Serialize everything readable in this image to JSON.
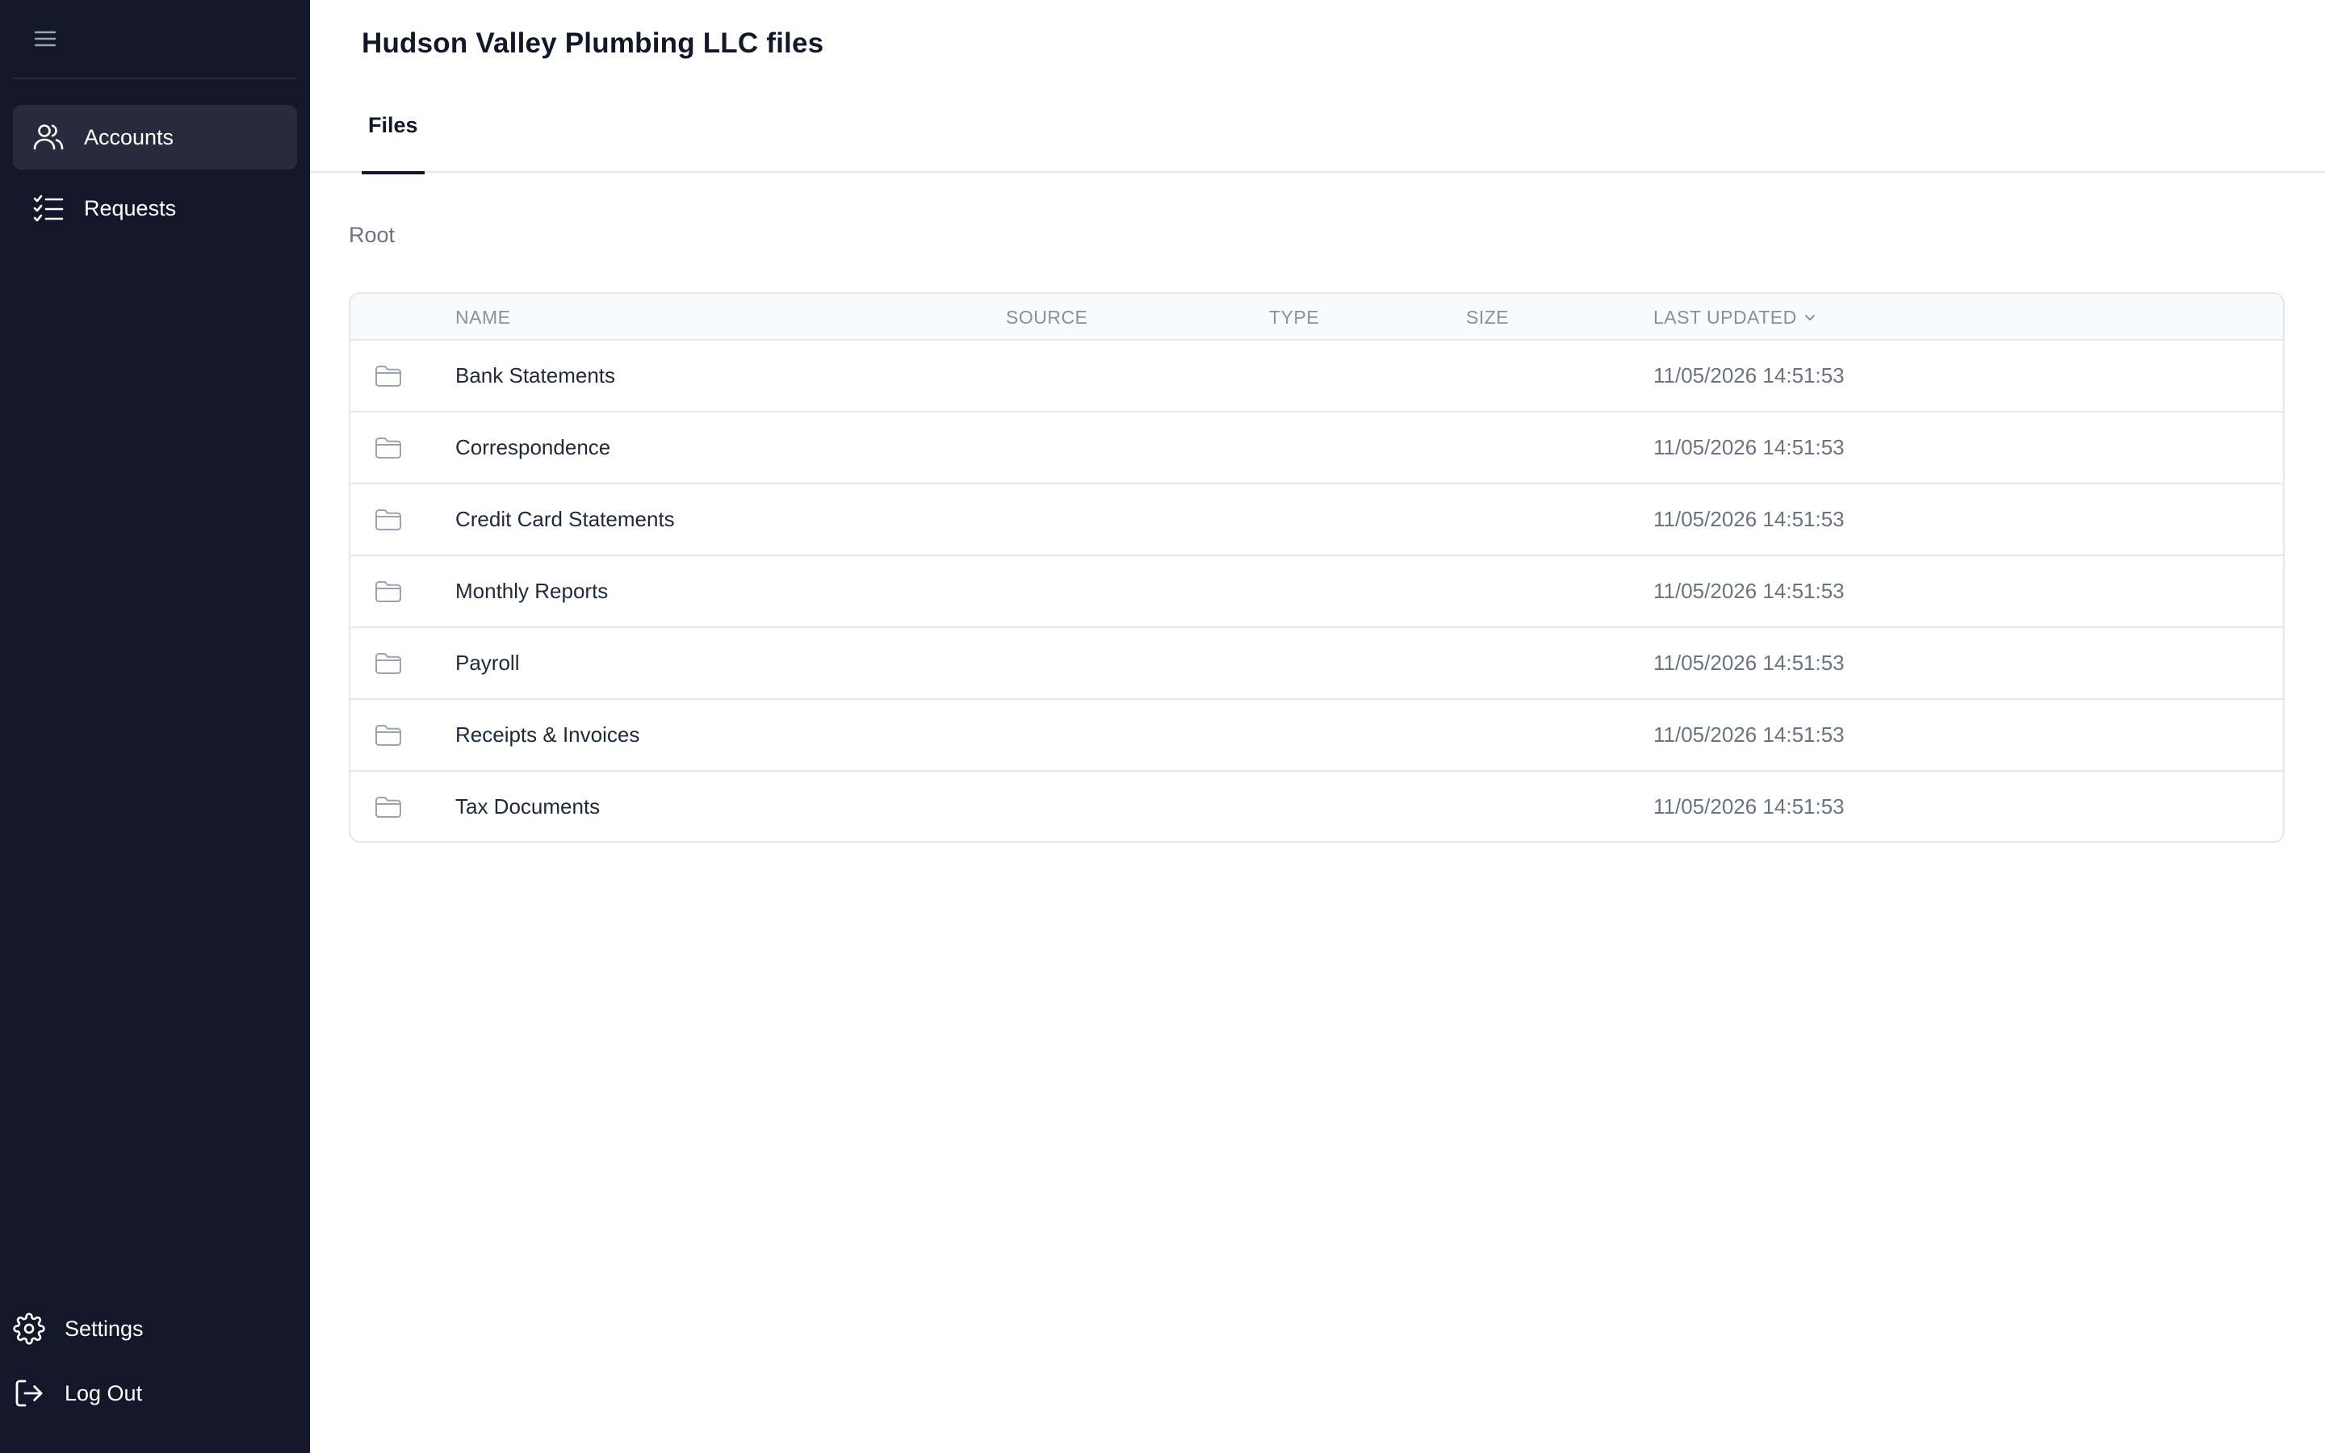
{
  "sidebar": {
    "menu_icon": "hamburger-icon",
    "items": [
      {
        "label": "Accounts",
        "icon": "users-icon",
        "active": true
      },
      {
        "label": "Requests",
        "icon": "checklist-icon",
        "active": false
      }
    ],
    "bottom": [
      {
        "label": "Settings",
        "icon": "gear-icon"
      },
      {
        "label": "Log Out",
        "icon": "logout-icon"
      }
    ]
  },
  "header": {
    "title": "Hudson Valley Plumbing LLC files",
    "tabs": [
      {
        "label": "Files",
        "active": true
      }
    ]
  },
  "breadcrumb": {
    "root": "Root"
  },
  "table": {
    "columns": {
      "name": "NAME",
      "source": "SOURCE",
      "type": "TYPE",
      "size": "SIZE",
      "last_updated": "LAST UPDATED"
    },
    "sort_icon": "chevron-down-icon",
    "rows": [
      {
        "name": "Bank Statements",
        "source": "",
        "type": "",
        "size": "",
        "last_updated": "11/05/2026 14:51:53",
        "icon": "folder-icon"
      },
      {
        "name": "Correspondence",
        "source": "",
        "type": "",
        "size": "",
        "last_updated": "11/05/2026 14:51:53",
        "icon": "folder-icon"
      },
      {
        "name": "Credit Card Statements",
        "source": "",
        "type": "",
        "size": "",
        "last_updated": "11/05/2026 14:51:53",
        "icon": "folder-icon"
      },
      {
        "name": "Monthly Reports",
        "source": "",
        "type": "",
        "size": "",
        "last_updated": "11/05/2026 14:51:53",
        "icon": "folder-icon"
      },
      {
        "name": "Payroll",
        "source": "",
        "type": "",
        "size": "",
        "last_updated": "11/05/2026 14:51:53",
        "icon": "folder-icon"
      },
      {
        "name": "Receipts & Invoices",
        "source": "",
        "type": "",
        "size": "",
        "last_updated": "11/05/2026 14:51:53",
        "icon": "folder-icon"
      },
      {
        "name": "Tax Documents",
        "source": "",
        "type": "",
        "size": "",
        "last_updated": "11/05/2026 14:51:53",
        "icon": "folder-icon"
      }
    ]
  },
  "colors": {
    "sidebar_bg": "#121829",
    "sidebar_active": "#262c3d",
    "text_primary": "#111827",
    "text_muted": "#6b7280",
    "border": "#e5e7eb"
  }
}
